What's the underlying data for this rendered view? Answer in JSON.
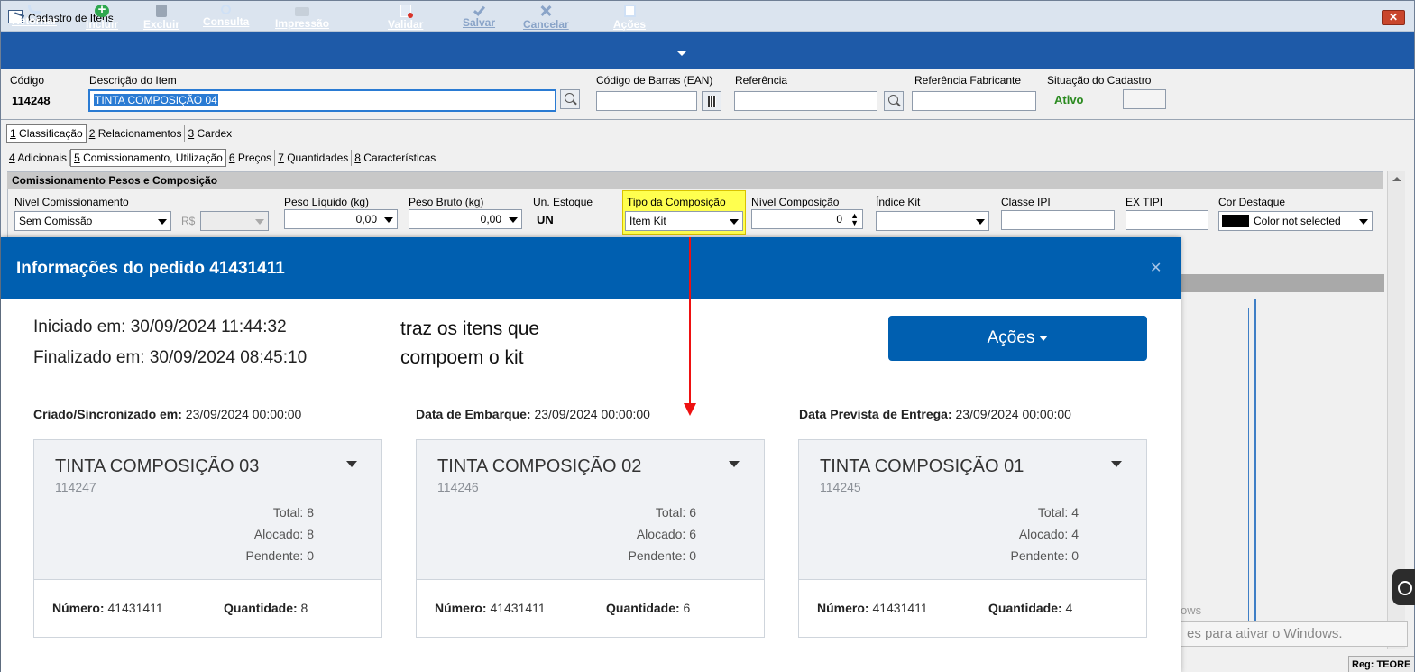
{
  "window": {
    "title": "Cadastro de Itens",
    "close_label": "✕"
  },
  "toolbar": {
    "retornar": "Retornar",
    "incluir": "Incluir",
    "excluir": "Excluir",
    "consulta": "Consulta",
    "impressao": "Impressão",
    "validar": "Validar",
    "salvar": "Salvar",
    "cancelar": "Cancelar",
    "acoes": "Ações"
  },
  "header": {
    "codigo_label": "Código",
    "codigo_value": "114248",
    "descricao_label": "Descrição do Item",
    "descricao_value": "TINTA COMPOSIÇÃO 04",
    "ean_label": "Código de Barras (EAN)",
    "ean_value": "",
    "referencia_label": "Referência",
    "referencia_value": "",
    "ref_fab_label": "Referência Fabricante",
    "ref_fab_value": "",
    "situacao_label": "Situação do Cadastro",
    "situacao_value": "Ativo",
    "situacao_color": "#2a8a1f"
  },
  "tabs_row1": [
    {
      "key": "1",
      "label": " Classificação"
    },
    {
      "key": "2",
      "label": " Relacionamentos"
    },
    {
      "key": "3",
      "label": " Cardex"
    }
  ],
  "tabs_row2": [
    {
      "key": "4",
      "label": " Adicionais"
    },
    {
      "key": "5",
      "label": " Comissionamento, Utilização"
    },
    {
      "key": "6",
      "label": " Preços"
    },
    {
      "key": "7",
      "label": " Quantidades"
    },
    {
      "key": "8",
      "label": " Características"
    }
  ],
  "panel": {
    "title": "Comissionamento Pesos e Composição",
    "nivel_comissionamento_label": "Nível Comissionamento",
    "nivel_comissionamento_value": "Sem Comissão",
    "rs_label": "R$",
    "peso_liquido_label": "Peso Líquido (kg)",
    "peso_liquido_value": "0,00",
    "peso_bruto_label": "Peso Bruto  (kg)",
    "peso_bruto_value": "0,00",
    "un_estoque_label": "Un. Estoque",
    "un_estoque_value": "UN",
    "tipo_composicao_label": "Tipo da Composição",
    "tipo_composicao_value": "Item Kit",
    "nivel_composicao_label": "Nível Composição",
    "nivel_composicao_value": "0",
    "indice_kit_label": "Índice Kit",
    "classe_ipi_label": "Classe IPI",
    "ex_tipi_label": "EX TIPI",
    "cor_destaque_label": "Cor Destaque",
    "cor_destaque_value": "Color not selected"
  },
  "background": {
    "watermark": "ows",
    "activate_text": "es para ativar o Windows.",
    "status": "Reg: TEORE"
  },
  "modal": {
    "title": "Informações do pedido 41431411",
    "close": "✕",
    "iniciado": "Iniciado em: 30/09/2024 11:44:32",
    "finalizado": "Finalizado em: 30/09/2024 08:45:10",
    "note_line1": "traz os itens que",
    "note_line2": "compoem o kit",
    "acoes_label": "Ações",
    "criado_label": "Criado/Sincronizado em:",
    "criado_value": " 23/09/2024 00:00:00",
    "embarque_label": "Data de Embarque:",
    "embarque_value": " 23/09/2024 00:00:00",
    "entrega_label": "Data Prevista de Entrega:",
    "entrega_value": " 23/09/2024 00:00:00",
    "cards": [
      {
        "name": "TINTA COMPOSIÇÃO 03",
        "code": "114247",
        "total": "Total: 8",
        "alocado": "Alocado: 8",
        "pendente": "Pendente: 0",
        "numero_label": "Número:",
        "numero": " 41431411",
        "quantidade_label": "Quantidade:",
        "quantidade": " 8"
      },
      {
        "name": "TINTA COMPOSIÇÃO 02",
        "code": "114246",
        "total": "Total: 6",
        "alocado": "Alocado: 6",
        "pendente": "Pendente: 0",
        "numero_label": "Número:",
        "numero": " 41431411",
        "quantidade_label": "Quantidade:",
        "quantidade": " 6"
      },
      {
        "name": "TINTA COMPOSIÇÃO 01",
        "code": "114245",
        "total": "Total: 4",
        "alocado": "Alocado: 4",
        "pendente": "Pendente: 0",
        "numero_label": "Número:",
        "numero": " 41431411",
        "quantidade_label": "Quantidade:",
        "quantidade": " 4"
      }
    ]
  }
}
